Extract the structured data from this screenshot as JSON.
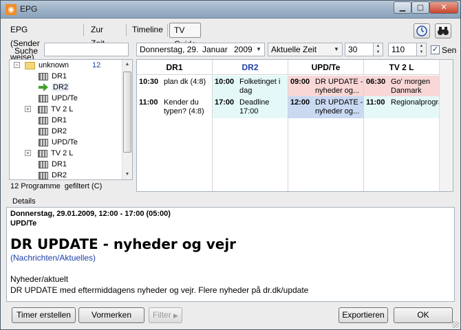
{
  "window": {
    "title": "EPG",
    "app_icon": "rss-icon",
    "min_icon": "minimize-icon",
    "max_icon": "maximize-icon",
    "close_icon": "close-icon"
  },
  "toolbar": {
    "tabs": [
      "EPG (Sender weise)",
      "Zur Zeit",
      "Timeline",
      "TV Guide"
    ],
    "active_tab": "TV Guide",
    "icons": [
      "clock-icon",
      "binoculars-icon"
    ]
  },
  "search": {
    "label": "Suche",
    "value": "",
    "date_day": "Donnerstag, 29.",
    "date_month": "Januar",
    "date_year": "2009",
    "time_option": "Aktuelle Zeit",
    "spin1": "30",
    "spin2": "110",
    "check_label": "Sen",
    "check_checked": true
  },
  "tree": {
    "root": {
      "label": "unknown",
      "count": "12"
    },
    "items": [
      {
        "label": "DR1",
        "icon": "film-icon",
        "expander": false
      },
      {
        "label": "DR2",
        "icon": "arrow-icon",
        "expander": false,
        "selected": true
      },
      {
        "label": "UPD/Te",
        "icon": "film-icon",
        "expander": false
      },
      {
        "label": "TV 2 L",
        "icon": "film-icon",
        "expander": true
      },
      {
        "label": "DR1",
        "icon": "film-icon",
        "expander": false
      },
      {
        "label": "DR2",
        "icon": "film-icon",
        "expander": false
      },
      {
        "label": "UPD/Te",
        "icon": "film-icon",
        "expander": false
      },
      {
        "label": "TV 2 L",
        "icon": "film-icon",
        "expander": true
      },
      {
        "label": "DR1",
        "icon": "film-icon",
        "expander": false
      },
      {
        "label": "DR2",
        "icon": "film-icon",
        "expander": false
      }
    ]
  },
  "status": {
    "programs": "12 Programme",
    "filter": "gefiltert (C)"
  },
  "guide": {
    "columns": [
      {
        "name": "DR1",
        "highlight": false,
        "programs": [
          {
            "time": "10:30",
            "title": "plan dk (4:8)",
            "color": "#ffffff"
          },
          {
            "time": "11:00",
            "title": "Kender du typen? (4:8)",
            "color": "#ffffff"
          }
        ]
      },
      {
        "name": "DR2",
        "highlight": true,
        "programs": [
          {
            "time": "10:00",
            "title": "Folketinget i dag",
            "color": "#e4f8f8"
          },
          {
            "time": "17:00",
            "title": "Deadline 17:00",
            "color": "#e4f8f8"
          }
        ]
      },
      {
        "name": "UPD/Te",
        "highlight": false,
        "programs": [
          {
            "time": "09:00",
            "title": "DR UPDATE - nyheder og...",
            "color": "#f9d7d7"
          },
          {
            "time": "12:00",
            "title": "DR UPDATE - nyheder og...",
            "color": "#c9d9f2"
          }
        ]
      },
      {
        "name": "TV 2 L",
        "highlight": false,
        "programs": [
          {
            "time": "06:30",
            "title": "Go' morgen Danmark",
            "color": "#f9d7d7"
          },
          {
            "time": "11:00",
            "title": "Regionalprogrammer",
            "color": "#e4f8f8"
          }
        ]
      }
    ]
  },
  "details": {
    "label": "Details",
    "line1": "Donnerstag, 29.01.2009, 12:00 - 17:00  (05:00)",
    "line2": "UPD/Te",
    "title": "DR UPDATE - nyheder og vejr",
    "genre": "(Nachrichten/Aktuelles)",
    "category": "Nyheder/aktuelt",
    "description": "DR UPDATE med eftermiddagens nyheder og vejr. Flere nyheder på dr.dk/update"
  },
  "buttons": {
    "timer": "Timer erstellen",
    "remember": "Vormerken",
    "filter": "Filter",
    "export": "Exportieren",
    "ok": "OK"
  }
}
